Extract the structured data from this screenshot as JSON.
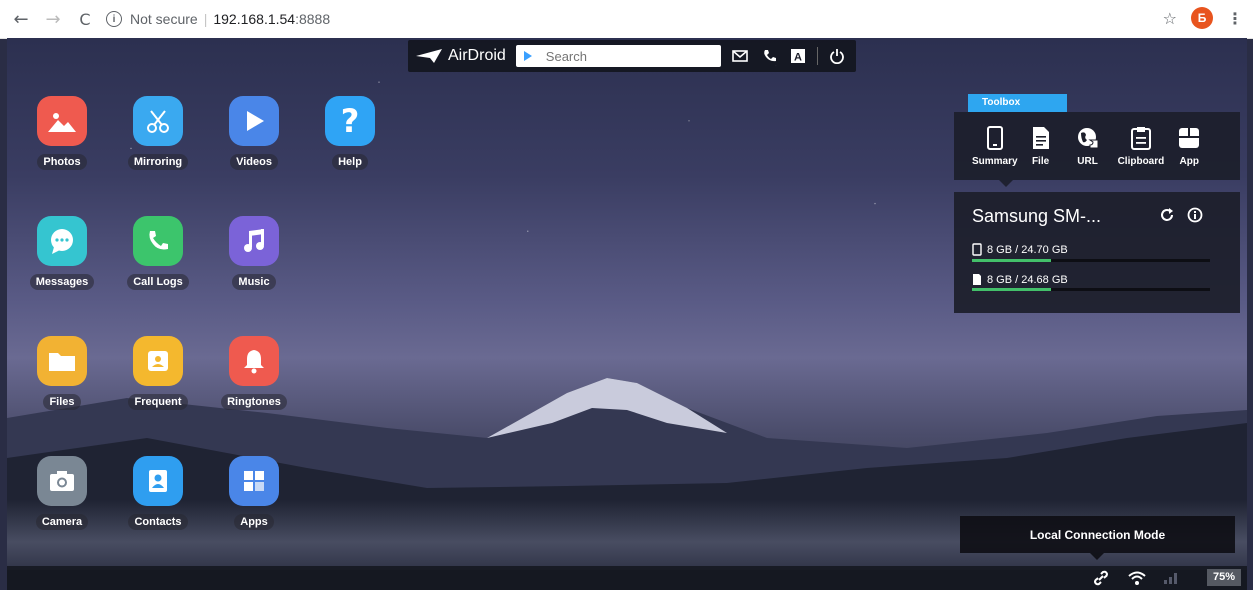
{
  "browser": {
    "security_label": "Not secure",
    "url_host": "192.168.1.54",
    "url_port": ":8888",
    "avatar_letter": "Б"
  },
  "topbar": {
    "logo_text": "AirDroid",
    "search_placeholder": "Search"
  },
  "apps": [
    {
      "label": "Photos",
      "icon": "photos-icon",
      "color": "#ef5a4f"
    },
    {
      "label": "Mirroring",
      "icon": "mirroring-icon",
      "color": "#3aa9f0"
    },
    {
      "label": "Videos",
      "icon": "videos-icon",
      "color": "#4a86e8"
    },
    {
      "label": "Help",
      "icon": "help-icon",
      "color": "#2fa4f5"
    },
    {
      "label": "Messages",
      "icon": "messages-icon",
      "color": "#35c5d0"
    },
    {
      "label": "Call Logs",
      "icon": "call-logs-icon",
      "color": "#3cc56c"
    },
    {
      "label": "Music",
      "icon": "music-icon",
      "color": "#7b63d8"
    },
    {
      "label": "Files",
      "icon": "files-icon",
      "color": "#f2b233"
    },
    {
      "label": "Frequent",
      "icon": "frequent-icon",
      "color": "#f4b82e"
    },
    {
      "label": "Ringtones",
      "icon": "ringtones-icon",
      "color": "#ef5a4f"
    },
    {
      "label": "Camera",
      "icon": "camera-icon",
      "color": "#7a8794"
    },
    {
      "label": "Contacts",
      "icon": "contacts-icon",
      "color": "#2f9ef0"
    },
    {
      "label": "Apps",
      "icon": "apps-icon",
      "color": "#4a86e8"
    }
  ],
  "toolbox": {
    "tab_label": "Toolbox",
    "tools": [
      {
        "label": "Summary",
        "icon": "phone-icon"
      },
      {
        "label": "File",
        "icon": "file-icon"
      },
      {
        "label": "URL",
        "icon": "globe-icon"
      },
      {
        "label": "Clipboard",
        "icon": "clipboard-icon"
      },
      {
        "label": "App",
        "icon": "app-box-icon"
      }
    ]
  },
  "device": {
    "name": "Samsung SM-...",
    "internal_storage": "8 GB / 24.70 GB",
    "internal_used_fraction": 0.33,
    "sd_storage": "8 GB / 24.68 GB",
    "sd_used_fraction": 0.33
  },
  "connection": {
    "mode_label": "Local Connection Mode"
  },
  "statusbar": {
    "battery": "75%"
  },
  "colors": {
    "accent": "#2ea6f0",
    "storage_fill": "#43c06a"
  }
}
